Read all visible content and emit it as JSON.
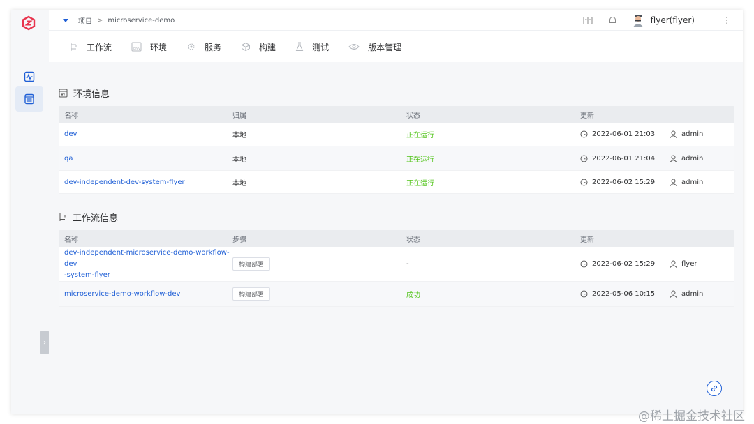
{
  "breadcrumb": {
    "root": "项目",
    "separator": ">",
    "current": "microservice-demo"
  },
  "user": {
    "name": "flyer(flyer)"
  },
  "tabs": [
    {
      "label": "工作流",
      "icon": "workflow-icon"
    },
    {
      "label": "环境",
      "icon": "environment-icon"
    },
    {
      "label": "服务",
      "icon": "service-icon"
    },
    {
      "label": "构建",
      "icon": "build-icon"
    },
    {
      "label": "测试",
      "icon": "test-icon"
    },
    {
      "label": "版本管理",
      "icon": "version-icon"
    }
  ],
  "env_section": {
    "title": "环境信息",
    "headers": [
      "名称",
      "归属",
      "状态",
      "更新"
    ],
    "rows": [
      {
        "name": "dev",
        "owner": "本地",
        "status": "正在运行",
        "time": "2022-06-01 21:03",
        "user": "admin"
      },
      {
        "name": "qa",
        "owner": "本地",
        "status": "正在运行",
        "time": "2022-06-01 21:04",
        "user": "admin"
      },
      {
        "name": "dev-independent-dev-system-flyer",
        "owner": "本地",
        "status": "正在运行",
        "time": "2022-06-02 15:29",
        "user": "admin"
      }
    ]
  },
  "workflow_section": {
    "title": "工作流信息",
    "headers": [
      "名称",
      "步骤",
      "状态",
      "更新"
    ],
    "rows": [
      {
        "name_line1": "dev-independent-microservice-demo-workflow-dev",
        "name_line2": "-system-flyer",
        "step": "构建部署",
        "status": "-",
        "time": "2022-06-02 15:29",
        "user": "flyer"
      },
      {
        "name_line1": "microservice-demo-workflow-dev",
        "step": "构建部署",
        "status": "成功",
        "time": "2022-05-06 10:15",
        "user": "admin"
      }
    ]
  },
  "watermark": "@稀土掘金技术社区",
  "colors": {
    "accent": "#1f5fd6",
    "success": "#52c41a",
    "logo": "#e8344e"
  }
}
